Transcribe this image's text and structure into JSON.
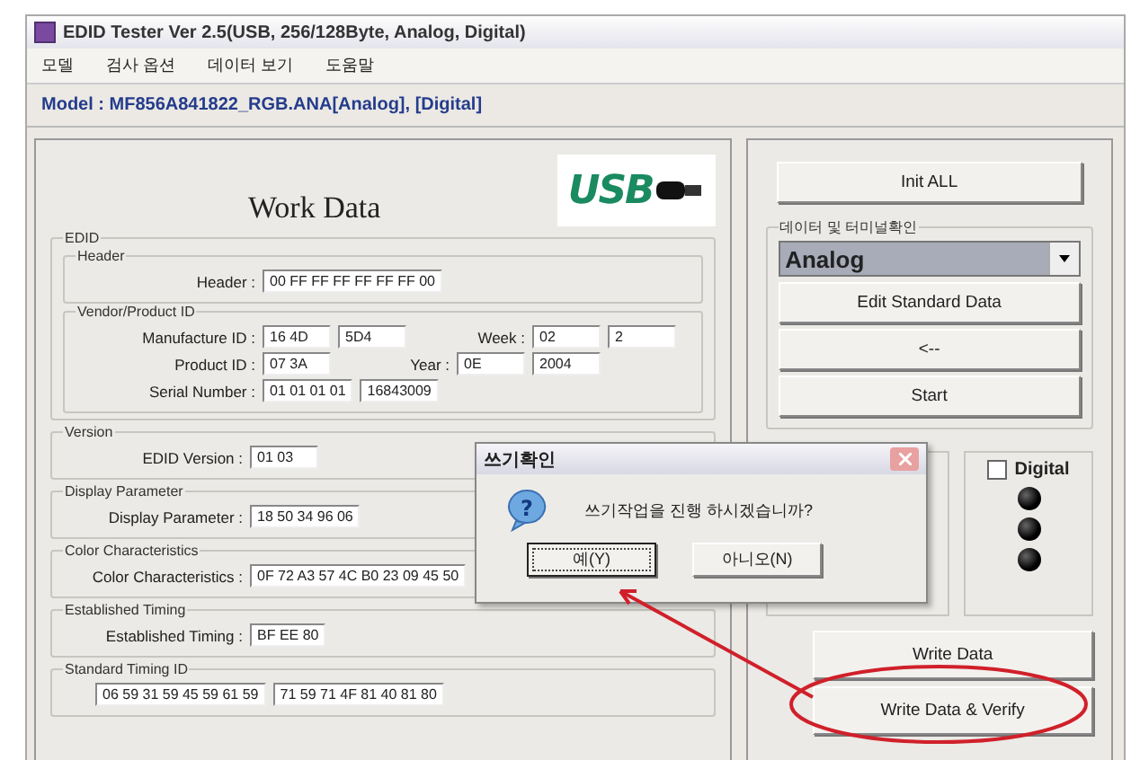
{
  "window": {
    "title": "EDID Tester Ver 2.5(USB, 256/128Byte, Analog, Digital)"
  },
  "menu": [
    "모델",
    "검사 옵션",
    "데이터 보기",
    "도움말"
  ],
  "model_line": "Model : MF856A841822_RGB.ANA[Analog], [Digital]",
  "work_data": {
    "title": "Work Data",
    "logo_text": "USB",
    "edid_label": "EDID",
    "groups": [
      {
        "title": "Header",
        "rows": [
          [
            {
              "label": "Header :",
              "values": [
                "00 FF FF FF FF FF FF 00"
              ]
            }
          ]
        ]
      },
      {
        "title": "Vendor/Product ID",
        "rows": [
          [
            {
              "label": "Manufacture ID :",
              "values": [
                "16 4D",
                "5D4"
              ]
            },
            {
              "label": "Week :",
              "values": [
                "02",
                "2"
              ]
            }
          ],
          [
            {
              "label": "Product ID :",
              "values": [
                "07 3A"
              ]
            },
            {
              "label": "Year :",
              "values": [
                "0E",
                "2004"
              ]
            }
          ],
          [
            {
              "label": "Serial Number :",
              "values": [
                "01 01 01 01",
                "16843009"
              ]
            }
          ]
        ]
      },
      {
        "title": "Version",
        "rows": [
          [
            {
              "label": "EDID Version :",
              "values": [
                "01 03"
              ]
            }
          ]
        ]
      },
      {
        "title": "Display Parameter",
        "rows": [
          [
            {
              "label": "Display Parameter :",
              "values": [
                "18 50 34 96 06"
              ]
            }
          ]
        ]
      },
      {
        "title": "Color Characteristics",
        "rows": [
          [
            {
              "label": "Color Characteristics :",
              "values": [
                "0F 72 A3 57 4C B0 23 09 45 50"
              ]
            }
          ]
        ]
      },
      {
        "title": "Established Timing",
        "rows": [
          [
            {
              "label": "Established Timing :",
              "values": [
                "BF EE 80"
              ]
            }
          ]
        ]
      },
      {
        "title": "Standard Timing ID",
        "rows": [
          [
            {
              "values": [
                "06 59 31 59 45 59 61 59",
                "71 59 71 4F 81 40 81 80"
              ]
            }
          ]
        ]
      }
    ]
  },
  "control_panel": {
    "init_button": "Init ALL",
    "group_title": "데이터 및 터미널확인",
    "combo_value": "Analog",
    "buttons": [
      "Edit Standard Data",
      "<--",
      "Start"
    ],
    "digital_checkbox": {
      "label": "Digital",
      "checked": false
    },
    "action_buttons": [
      "Write Data",
      "Write Data & Verify"
    ]
  },
  "dialog": {
    "title": "쓰기확인",
    "icon": "?",
    "message": "쓰기작업을 진행 하시겠습니까?",
    "buttons": [
      {
        "label": "예(Y)",
        "selected": true
      },
      {
        "label": "아니오(N)",
        "selected": false
      }
    ]
  }
}
